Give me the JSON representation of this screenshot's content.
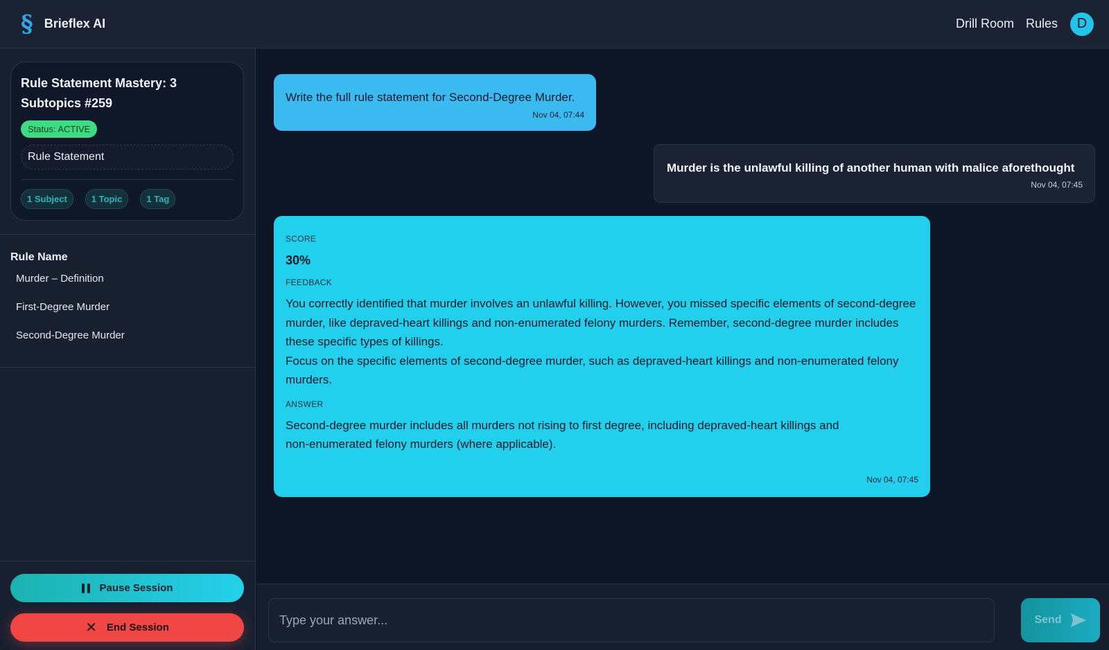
{
  "header": {
    "logo_glyph": "§",
    "app_name": "Brieflex AI",
    "nav": [
      "Drill Room",
      "Rules"
    ],
    "avatar_initial": "D"
  },
  "session": {
    "title": "Rule Statement Mastery: 3 Subtopics #259",
    "status": "Status: ACTIVE",
    "type": "Rule Statement",
    "tags": [
      "1 Subject",
      "1 Topic",
      "1 Tag"
    ]
  },
  "rules": {
    "heading": "Rule Name",
    "items": [
      "Murder – Definition",
      "First-Degree Murder",
      "Second-Degree Murder"
    ]
  },
  "actions": {
    "pause_label": "Pause Session",
    "end_label": "End Session"
  },
  "messages": {
    "question": {
      "text": "Write the full rule statement for Second-Degree Murder.",
      "time": "Nov 04, 07:44"
    },
    "answer": {
      "text": "Murder is the unlawful killing of another human with malice aforethought",
      "time": "Nov 04, 07:45"
    },
    "feedback": {
      "score_label": "SCORE",
      "score": "30%",
      "feedback_label": "FEEDBACK",
      "feedback_p1": "You correctly identified that murder involves an unlawful killing. However, you missed specific elements of second-degree murder, like depraved-heart killings and non-enumerated felony murders. Remember, second-degree murder includes these specific types of killings.",
      "feedback_p2": "Focus on the specific elements of second-degree murder, such as depraved-heart killings and non-enumerated felony murders.",
      "answer_label": "ANSWER",
      "answer_text": "Second-degree murder includes all murders not rising to first degree, including depraved-heart killings and non-enumerated felony murders (where applicable).",
      "time": "Nov 04, 07:45"
    }
  },
  "composer": {
    "placeholder": "Type your answer...",
    "send_label": "Send"
  },
  "colors": {
    "accent_cyan": "#22d0ee",
    "question_blue": "#3bbaf2",
    "status_green": "#3ddc84",
    "danger_red": "#f04646"
  }
}
